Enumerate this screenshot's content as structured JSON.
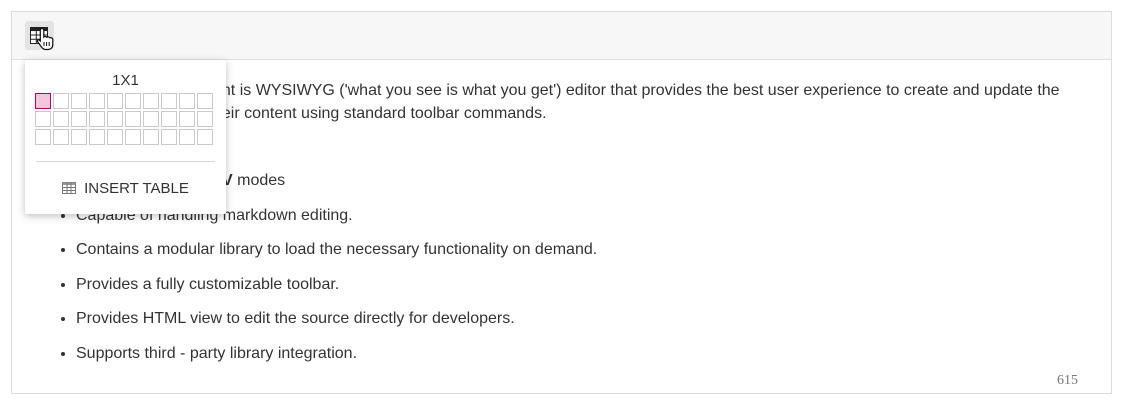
{
  "toolbar": {
    "buttons": [
      {
        "icon": "table-icon",
        "state": "hover"
      }
    ]
  },
  "content": {
    "paragraph_line1": "ent is WYSIWYG ('what you see is what you get') editor that provides the best user experience to create and update the",
    "paragraph_line2": "heir content using standard toolbar commands.",
    "list_items": [
      {
        "bold": "DIV",
        "text": " modes"
      },
      {
        "text": "Capable of handling markdown editing."
      },
      {
        "text": "Contains a modular library to load the necessary functionality on demand."
      },
      {
        "text": "Provides a fully customizable toolbar."
      },
      {
        "text": "Provides HTML view to edit the source directly for developers."
      },
      {
        "text": "Supports third - party library integration."
      }
    ],
    "word_count": "615"
  },
  "table_popup": {
    "size_label": "1X1",
    "rows": 3,
    "columns": 10,
    "selected_rows": 1,
    "selected_columns": 1,
    "insert_label": "INSERT TABLE"
  },
  "colors": {
    "selected_cell_border": "#c0005a",
    "selected_cell_fill": "#f4c6dc",
    "toolbar_bg": "#f7f7f7"
  }
}
